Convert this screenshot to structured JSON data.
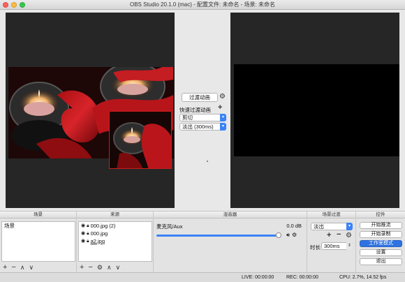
{
  "window": {
    "title": "OBS Studio 20.1.0 (mac) - 配置文件: 未命名 - 场景: 未命名"
  },
  "transition_panel": {
    "transition_button": "过渡动画",
    "quick_transitions_label": "快速过渡动画",
    "quick_select_1": "剪切",
    "quick_select_2": "淡出 (300ms)"
  },
  "dock": {
    "scenes": {
      "header": "场景",
      "items": [
        "场景"
      ]
    },
    "sources": {
      "header": "来源",
      "items": [
        {
          "name": "000.jpg (2)"
        },
        {
          "name": "000.jpg"
        },
        {
          "name": "a2.jpg"
        }
      ]
    },
    "mixer": {
      "header": "混音器",
      "channel_name": "麦克风/Aux",
      "channel_db": "0.0 dB",
      "level": 0.92
    },
    "scene_transitions": {
      "header": "场景过渡",
      "selected": "淡出",
      "duration_label": "时长",
      "duration_value": "300ms"
    },
    "controls": {
      "header": "控件",
      "buttons": [
        "开始推流",
        "开始录制",
        "工作室模式",
        "设置",
        "退出"
      ]
    }
  },
  "statusbar": {
    "live": "LIVE: 00:00:00",
    "rec": "REC: 00:00:00",
    "cpu": "CPU: 2.7%, 14.52 fps"
  },
  "colors": {
    "accent": "#3b83f6",
    "active_button": "#2f73e0",
    "overlay_border": "#c81e1e",
    "preview_background": "#262626"
  }
}
